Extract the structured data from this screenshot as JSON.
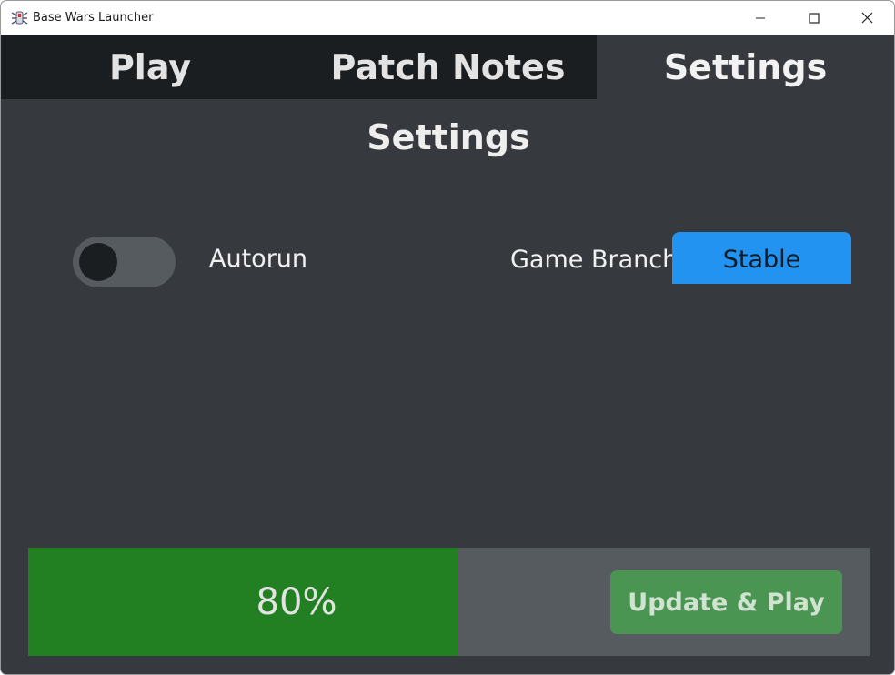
{
  "window": {
    "title": "Base Wars Launcher",
    "app_icon": "spider-icon",
    "controls": {
      "minimize_icon": "minimize-icon",
      "maximize_icon": "maximize-icon",
      "close_icon": "close-icon"
    }
  },
  "tabs": [
    {
      "label": "Play",
      "active": false
    },
    {
      "label": "Patch Notes",
      "active": false
    },
    {
      "label": "Settings",
      "active": true
    }
  ],
  "settings": {
    "title": "Settings",
    "autorun": {
      "label": "Autorun",
      "enabled": false
    },
    "game_branch": {
      "label": "Game Branch",
      "value": "Stable"
    }
  },
  "footer": {
    "progress_percent": 80,
    "progress_label": "80%",
    "update_button_label": "Update & Play"
  },
  "colors": {
    "background": "#363a3f",
    "tab_inactive": "#1b1e21",
    "accent_blue": "#2293f1",
    "progress_green": "#228022",
    "button_green": "#4a9552",
    "bar_track": "#565b60"
  }
}
